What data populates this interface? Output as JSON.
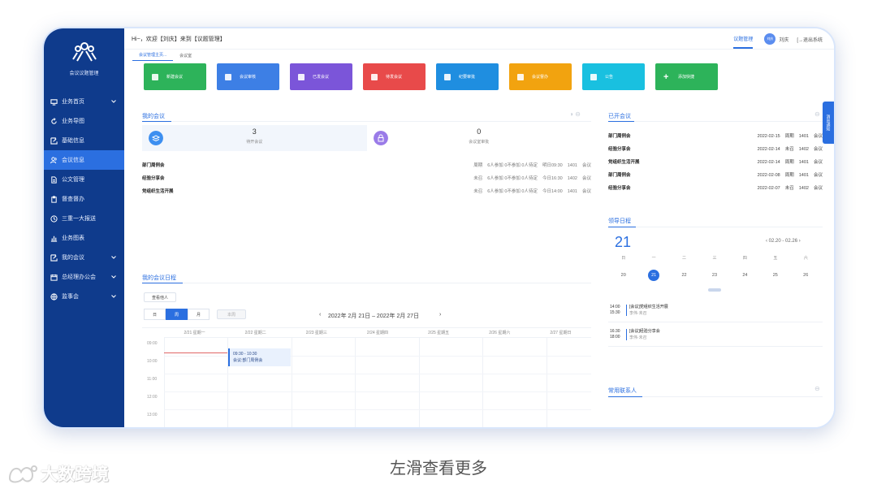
{
  "sidebar": {
    "logo_text": "会议议题管理",
    "items": [
      {
        "label": "业务首页",
        "caret": true
      },
      {
        "label": "业务导图",
        "caret": false
      },
      {
        "label": "基础信息",
        "caret": false
      },
      {
        "label": "会议信息",
        "caret": false,
        "active": true
      },
      {
        "label": "公文管理",
        "caret": false
      },
      {
        "label": "督查督办",
        "caret": false
      },
      {
        "label": "三重一大报送",
        "caret": false
      },
      {
        "label": "业务图表",
        "caret": false
      },
      {
        "label": "我的会议",
        "caret": true
      },
      {
        "label": "总经理办公会",
        "caret": true
      },
      {
        "label": "监事会",
        "caret": true
      }
    ]
  },
  "topbar": {
    "greeting": "Hi~，欢迎【刘庆】来到【议题管理】",
    "module_link": "议题管理",
    "avatar_text": "刘庆",
    "user_name": "刘庆",
    "logout": "[→退出系统"
  },
  "tabs": [
    "会议管理主页...",
    "会议室"
  ],
  "quick_actions": [
    {
      "label": "新建会议",
      "color": "#2db35a"
    },
    {
      "label": "会议审核",
      "color": "#3d7fe5"
    },
    {
      "label": "已发会议",
      "color": "#7b55d9"
    },
    {
      "label": "待发会议",
      "color": "#e84a4a"
    },
    {
      "label": "纪要审批",
      "color": "#1f8ee0"
    },
    {
      "label": "会议督办",
      "color": "#f2a30f"
    },
    {
      "label": "公告",
      "color": "#19c0e0"
    },
    {
      "label": "添加快捷",
      "color": "#2db35a"
    }
  ],
  "my_meetings": {
    "title": "我的会议",
    "stats": [
      {
        "value": "3",
        "label": "待开会议",
        "color": "#3d8ff0"
      },
      {
        "value": "0",
        "label": "会议室审批",
        "color": "#9a7be8"
      }
    ],
    "rows": [
      {
        "title": "部门周例会",
        "status": "周期",
        "attend": "6人参加 0不参加 0人待定",
        "time": "明日09:30",
        "room": "1401",
        "type": "会议"
      },
      {
        "title": "经验分享会",
        "status": "未召",
        "attend": "6人参加 0不参加 0人待定",
        "time": "今日16:30",
        "room": "1402",
        "type": "会议"
      },
      {
        "title": "党组织生活开展",
        "status": "未召",
        "attend": "6人参加 0不参加 0人待定",
        "time": "今日14:00",
        "room": "1401",
        "type": "会议"
      }
    ]
  },
  "schedule": {
    "title": "我的会议日程",
    "view_others": "查看他人",
    "views": [
      "日",
      "周",
      "月"
    ],
    "this_week": "本周",
    "range": "2022年 2月 21日 – 2022年 2月 27日",
    "days": [
      "2/21 星期一",
      "2/22 星期二",
      "2/23 星期三",
      "2/24 星期四",
      "2/25 星期五",
      "2/26 星期六",
      "2/27 星期日"
    ],
    "times": [
      "09:00",
      "10:00",
      "11:00",
      "12:00",
      "13:00"
    ],
    "event": {
      "time": "09:30 - 10:30",
      "title": "会议:部门周例会"
    }
  },
  "held_meetings": {
    "title": "已开会议",
    "rows": [
      {
        "title": "部门周例会",
        "date": "2022-02-15",
        "status": "周期",
        "room": "1401",
        "type": "会议"
      },
      {
        "title": "经验分享会",
        "date": "2022-02-14",
        "status": "未召",
        "room": "1402",
        "type": "会议"
      },
      {
        "title": "党组织生活开展",
        "date": "2022-02-14",
        "status": "周期",
        "room": "1401",
        "type": "会议"
      },
      {
        "title": "部门周例会",
        "date": "2022-02-08",
        "status": "周期",
        "room": "1401",
        "type": "会议"
      },
      {
        "title": "经验分享会",
        "date": "2022-02-07",
        "status": "未召",
        "room": "1402",
        "type": "会议"
      }
    ]
  },
  "leader_schedule": {
    "title": "领导日程",
    "big_day": "21",
    "week_range": "02.20 - 02.26",
    "weekdays": [
      "日",
      "一",
      "二",
      "三",
      "四",
      "五",
      "六"
    ],
    "dates": [
      "20",
      "21",
      "22",
      "23",
      "24",
      "25",
      "26"
    ],
    "today_index": 1,
    "items": [
      {
        "start": "14:00",
        "end": "15:30",
        "title": "[会议]党组织生活开展",
        "sub": "李伟·未召"
      },
      {
        "start": "16:30",
        "end": "18:00",
        "title": "[会议]经验分享会",
        "sub": "李伟·未召"
      }
    ]
  },
  "contacts": {
    "title": "常用联系人"
  },
  "side_tab": "消息通知",
  "caption": "左滑查看更多",
  "watermark": "大数跨境"
}
